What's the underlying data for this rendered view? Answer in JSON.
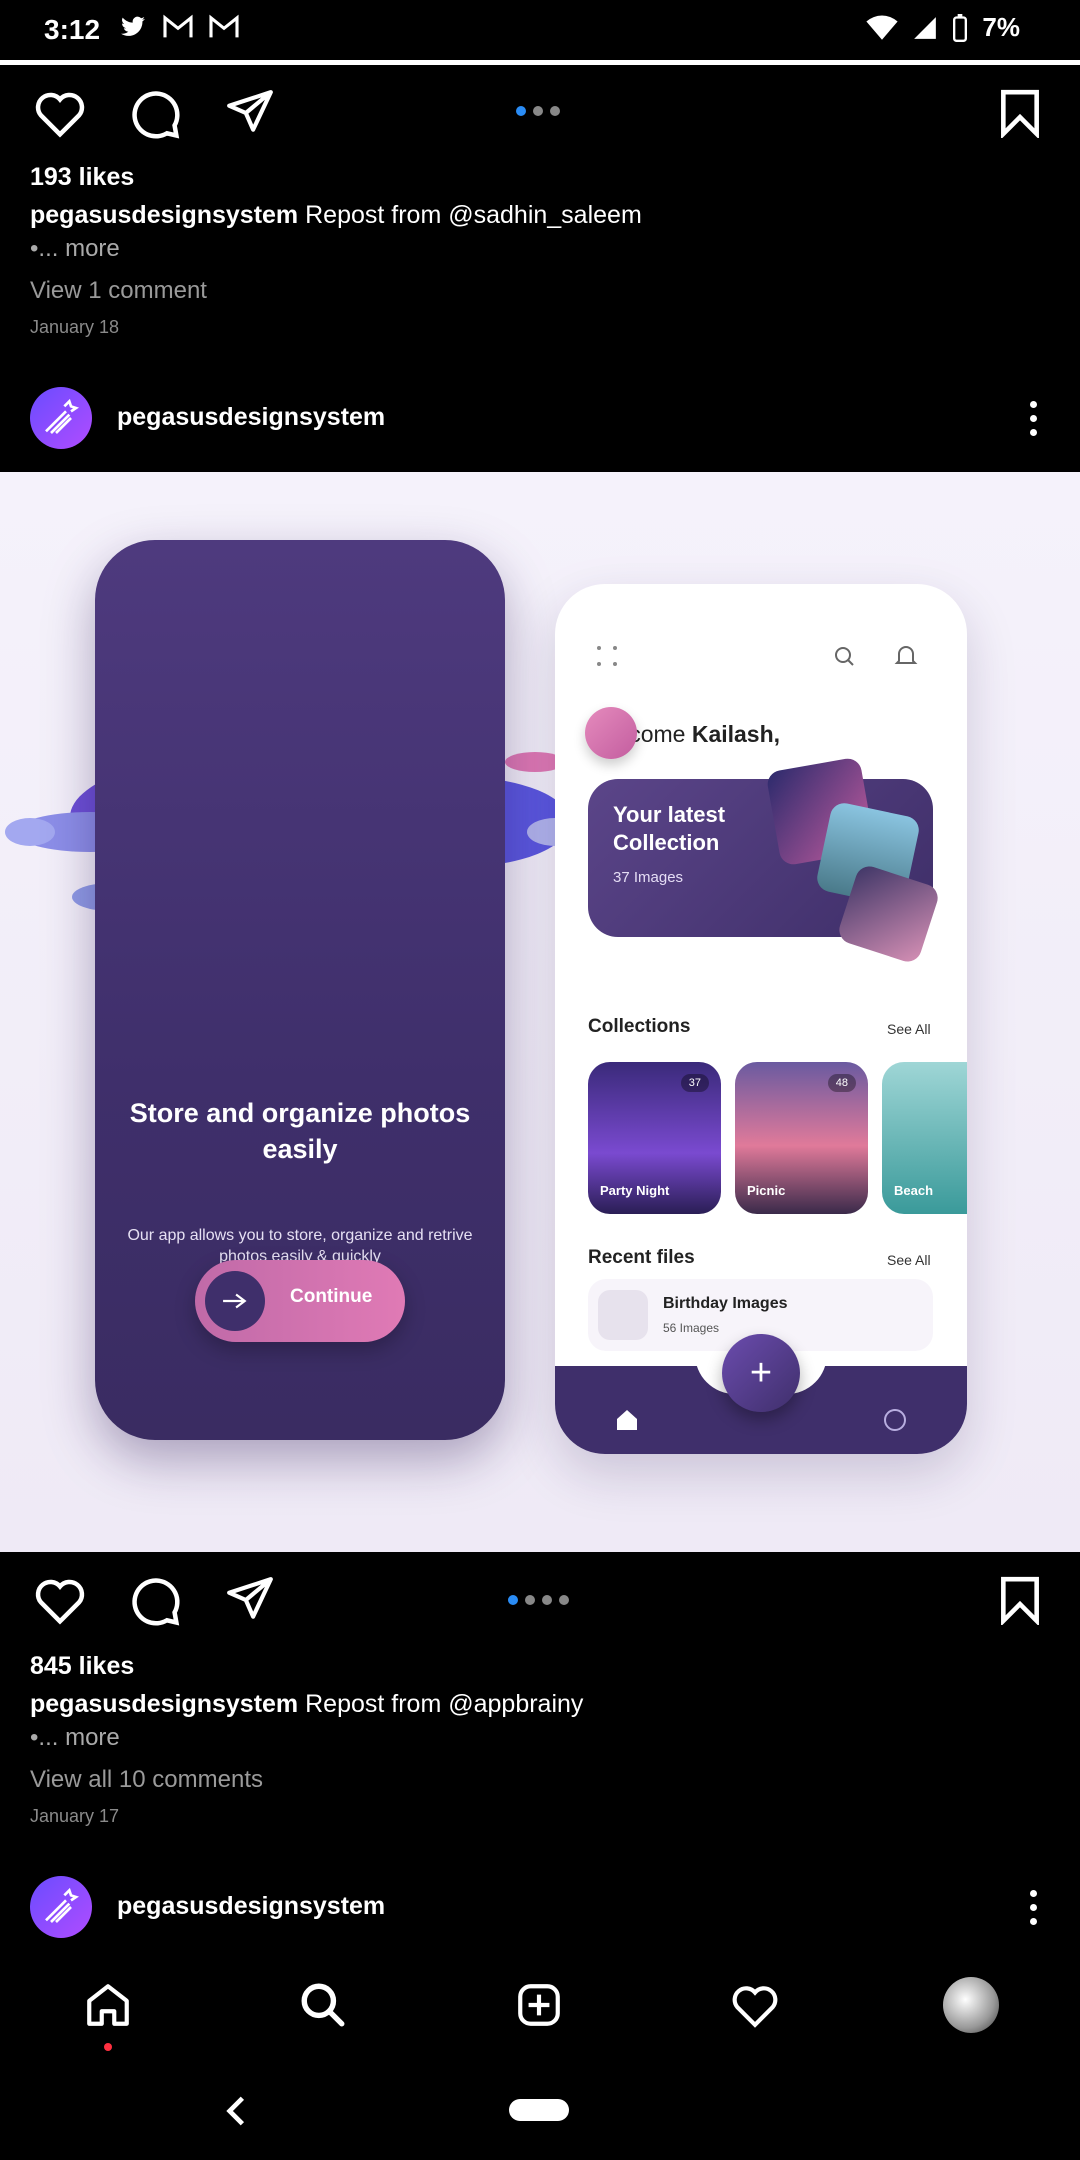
{
  "status_bar": {
    "time": "3:12",
    "battery": "7%"
  },
  "posts": [
    {
      "likes": "193 likes",
      "username": "pegasusdesignsystem",
      "caption": "Repost from @sadhin_saleem",
      "more": "•... more",
      "comments": "View 1 comment",
      "date": "January 18",
      "carousel_dots": 3,
      "carousel_active": 0
    },
    {
      "header_username": "pegasusdesignsystem",
      "likes": "845 likes",
      "username": "pegasusdesignsystem",
      "caption": "Repost from @appbrainy",
      "more": "•... more",
      "comments": "View all 10 comments",
      "date": "January 17",
      "carousel_dots": 4,
      "carousel_active": 0
    },
    {
      "header_username": "pegasusdesignsystem"
    }
  ],
  "post_image": {
    "left_phone": {
      "title": "Store and organize photos easily",
      "subtitle": "Our app allows you to store, organize and retrive photos easily & quickly",
      "button": "Continue"
    },
    "right_phone": {
      "welcome_prefix": "Welcome ",
      "welcome_name": "Kailash,",
      "collection_card": {
        "title": "Your latest Collection",
        "count": "37 Images"
      },
      "collections_title": "Collections",
      "see_all": "See All",
      "tiles": [
        {
          "label": "Party Night",
          "count": "37"
        },
        {
          "label": "Picnic",
          "count": "48"
        },
        {
          "label": "Beach",
          "count": ""
        }
      ],
      "recent_title": "Recent files",
      "recent_item": {
        "name": "Birthday Images",
        "sub": "56 Images"
      },
      "fab": "+"
    }
  },
  "icons": [
    "heart-icon",
    "comment-icon",
    "share-icon",
    "bookmark-icon",
    "home-icon",
    "search-icon",
    "add-icon",
    "activity-icon",
    "profile-icon",
    "back-icon"
  ],
  "colors": {
    "active_dot": "#2a8cf5",
    "background": "#000000",
    "notification_dot": "#ff3040"
  }
}
